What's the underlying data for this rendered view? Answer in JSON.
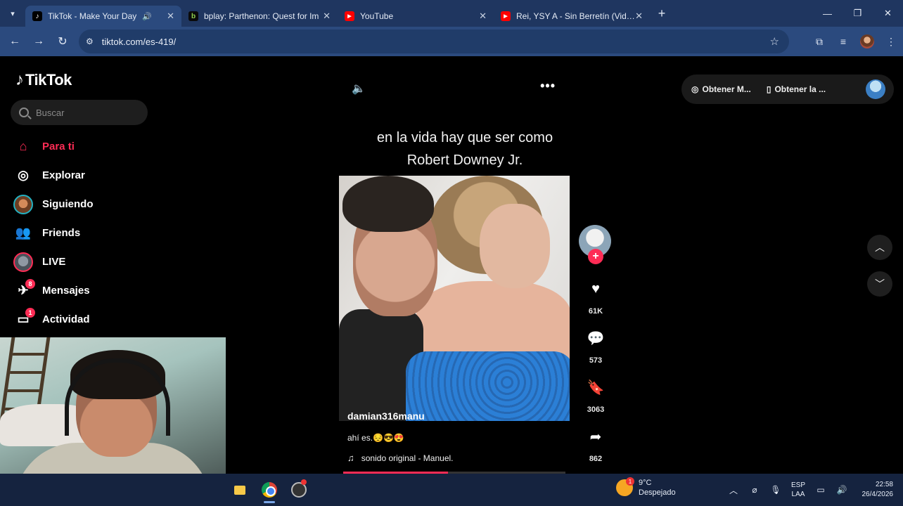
{
  "browser": {
    "tabs": [
      {
        "title": "TikTok - Make Your Day",
        "active": true,
        "audio": true
      },
      {
        "title": "bplay: Parthenon: Quest for Im",
        "active": false
      },
      {
        "title": "YouTube",
        "active": false
      },
      {
        "title": "Rei, YSY A - Sin Berretín (Video",
        "active": false
      }
    ],
    "new_tab": "+",
    "url": "tiktok.com/es-419/"
  },
  "tiktok": {
    "logo": "TikTok",
    "search_placeholder": "Buscar",
    "nav": [
      {
        "label": "Para ti",
        "icon": "home-icon",
        "active": true
      },
      {
        "label": "Explorar",
        "icon": "compass-icon"
      },
      {
        "label": "Siguiendo",
        "icon": "following-avatar"
      },
      {
        "label": "Friends",
        "icon": "friends-icon"
      },
      {
        "label": "LIVE",
        "icon": "live-avatar"
      },
      {
        "label": "Mensajes",
        "icon": "messages-icon",
        "badge": "8"
      },
      {
        "label": "Actividad",
        "icon": "activity-icon",
        "badge": "1"
      }
    ],
    "top_right": {
      "btn1": "Obtener M...",
      "btn2": "Obtener la ..."
    },
    "video": {
      "caption_line1": "en la vida hay que ser como",
      "caption_line2": "Robert Downey Jr.",
      "username": "damian316manu",
      "description": "ahí es.😔😎😍",
      "sound": "sonido original - Manuel.",
      "progress_fraction": 0.47,
      "likes": "61K",
      "comments": "573",
      "saves": "3063",
      "shares": "862"
    }
  },
  "taskbar": {
    "weather_temp": "9°C",
    "weather_desc": "Despejado",
    "weather_badge": "1",
    "lang_line1": "ESP",
    "lang_line2": "LAA",
    "time": "22:58",
    "date": "26/4/2026"
  },
  "colors": {
    "accent": "#fe2c55",
    "browser_tabbar": "#1f3660",
    "browser_toolbar": "#2b4a7e",
    "taskbar": "#15233f"
  }
}
